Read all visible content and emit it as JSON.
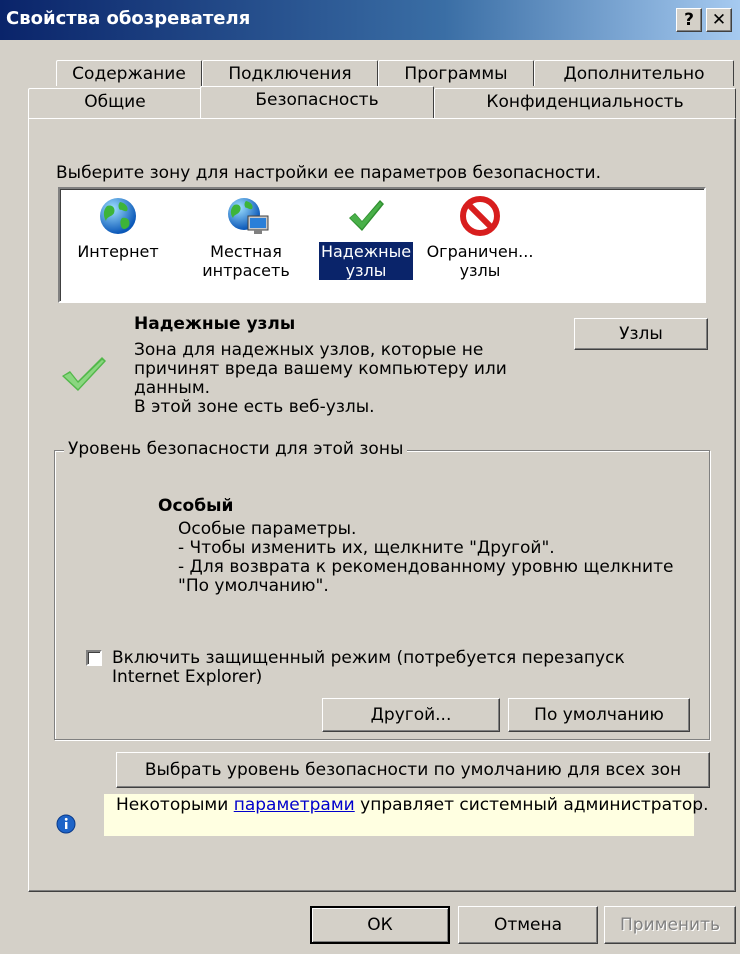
{
  "window": {
    "title": "Свойства обозревателя",
    "help_btn": "?",
    "close_btn": "✕"
  },
  "tabs_row1": [
    "Содержание",
    "Подключения",
    "Программы",
    "Дополнительно"
  ],
  "tabs_row2": [
    "Общие",
    "Безопасность",
    "Конфиденциальность"
  ],
  "active_tab": "Безопасность",
  "zone_prompt": "Выберите зону для настройки ее параметров безопасности.",
  "zones": [
    {
      "line1": "Интернет",
      "line2": "",
      "icon": "globe-icon"
    },
    {
      "line1": "Местная",
      "line2": "интрасеть",
      "icon": "intranet-icon"
    },
    {
      "line1": "Надежные",
      "line2": "узлы",
      "icon": "checkmark-icon",
      "selected": true
    },
    {
      "line1": "Ограничен...",
      "line2": "узлы",
      "icon": "no-entry-icon"
    }
  ],
  "zone_info": {
    "title": "Надежные узлы",
    "lines": [
      "Зона для надежных узлов, которые не",
      "причинят вреда вашему компьютеру или",
      "данным.",
      "В этой зоне есть веб-узлы."
    ],
    "sites_button": "Узлы"
  },
  "level_group": {
    "legend": "Уровень безопасности для этой зоны",
    "level_name": "Особый",
    "lines": [
      "Особые параметры.",
      "- Чтобы изменить их, щелкните \"Другой\".",
      "- Для возврата к рекомендованному уровню щелкните",
      "\"По умолчанию\"."
    ],
    "protected_mode_line1": "Включить защищенный режим (потребуется перезапуск",
    "protected_mode_line2": "Internet Explorer)",
    "protected_mode_checked": false,
    "custom_button": "Другой...",
    "default_button": "По умолчанию"
  },
  "reset_all_button": "Выбрать уровень безопасности по умолчанию для всех зон",
  "info_bar": {
    "before": "Некоторыми ",
    "link": "параметрами",
    "after": " управляет системный администратор.",
    "icon": "info-icon"
  },
  "footer": {
    "ok": "ОК",
    "cancel": "Отмена",
    "apply": "Применить"
  }
}
